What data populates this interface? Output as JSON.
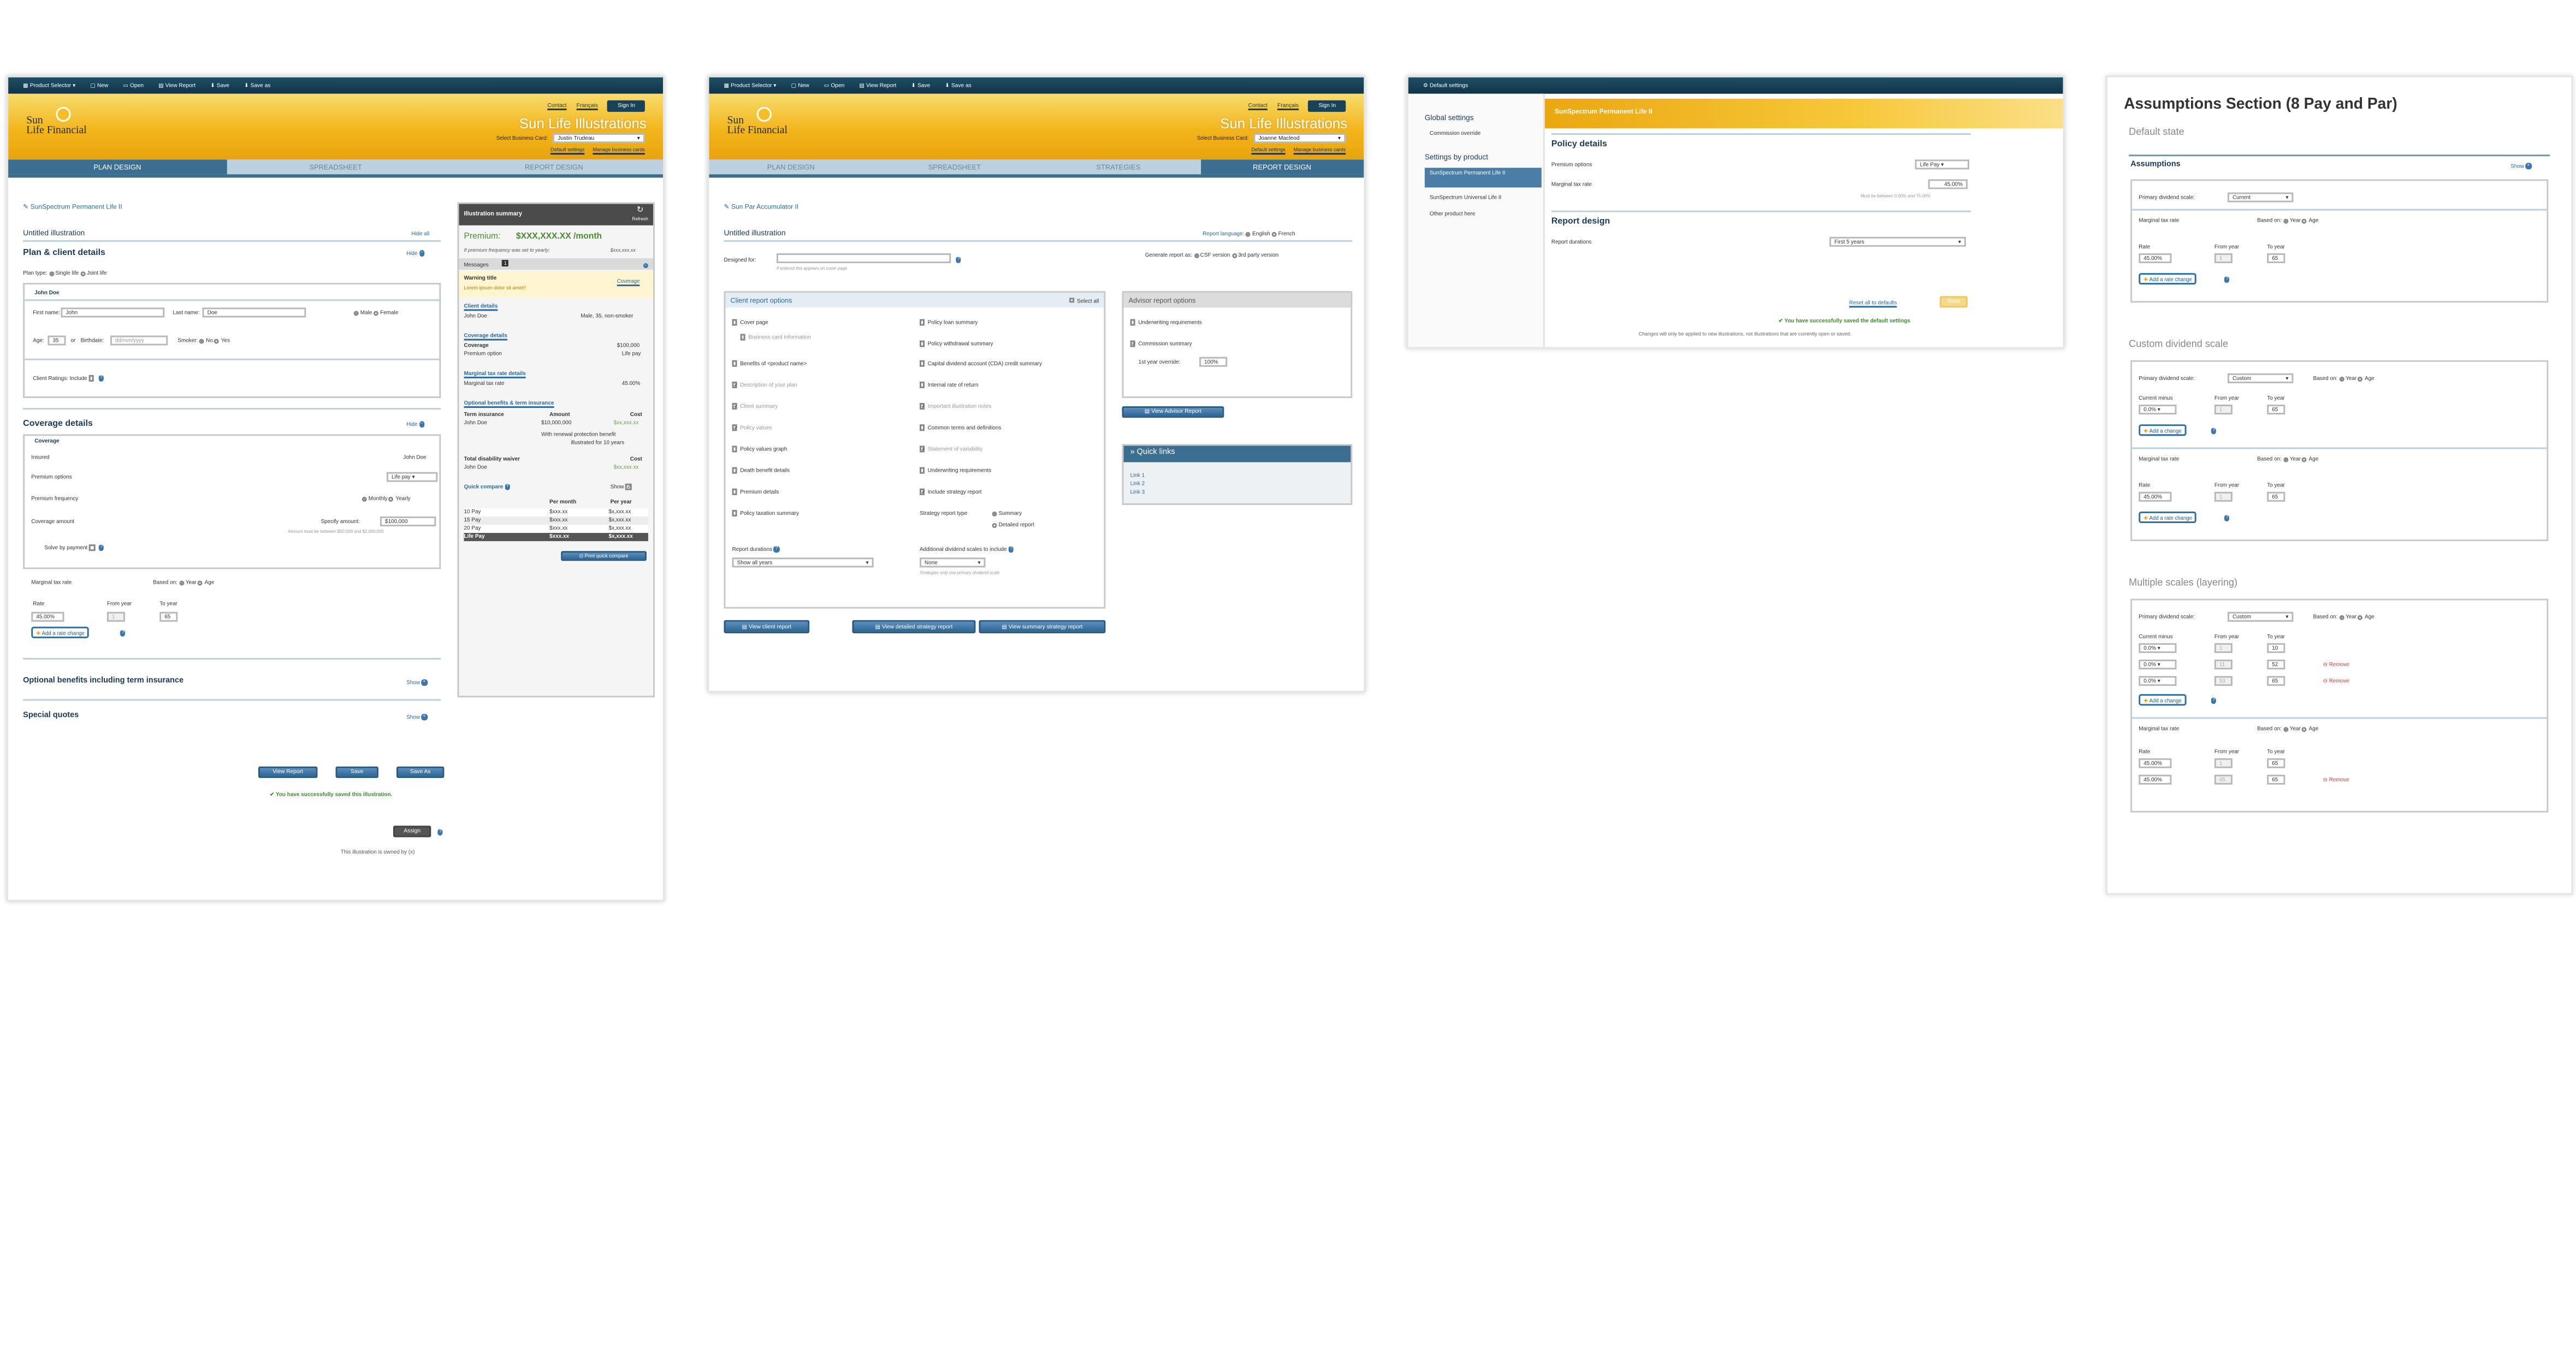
{
  "toolbar": {
    "product_selector": "Product Selector",
    "new": "New",
    "open": "Open",
    "view_report": "View Report",
    "save": "Save",
    "save_as": "Save as"
  },
  "header": {
    "contact": "Contact",
    "francais": "Français",
    "sign_in": "Sign In",
    "logo_line1": "Sun",
    "logo_line2": "Life Financial",
    "title": "Sun Life Illustrations",
    "select_card_label": "Select Business Card:",
    "default_settings": "Default settings",
    "manage_cards": "Manage business cards"
  },
  "screen1": {
    "business_card": "Justin Trudeau",
    "tabs": [
      "PLAN DESIGN",
      "SPREADSHEET",
      "REPORT DESIGN"
    ],
    "product": "SunSpectrum Permanent Life II",
    "illustration": "Untitled illustration",
    "hide_all": "Hide all",
    "hide": "Hide",
    "plan_client": "Plan & client details",
    "plan_type": "Plan type:",
    "single_life": "Single life",
    "joint_life": "Joint life",
    "client_name": "John Doe",
    "first_name_label": "First name:",
    "first_name": "John",
    "last_name_label": "Last name:",
    "last_name": "Doe",
    "male": "Male",
    "female": "Female",
    "age_label": "Age:",
    "age": "35",
    "or": "or",
    "birthdate_label": "Birthdate:",
    "birthdate_ph": "dd/mm/yyyy",
    "smoker_label": "Smoker:",
    "no": "No",
    "yes": "Yes",
    "client_ratings": "Client Ratings:",
    "include": "Include",
    "coverage_details": "Coverage details",
    "coverage": "Coverage",
    "insured": "Insured",
    "insured_value": "John Doe",
    "premium_options": "Premium options",
    "premium_value": "Life pay",
    "premium_frequency": "Premium frequency",
    "monthly": "Monthly",
    "yearly": "Yearly",
    "coverage_amount": "Coverage amount",
    "specify_amount": "Specify amount:",
    "amount": "$100,000",
    "amount_hint": "Amount must be between $50,000 and $2,000,000",
    "solve_by_premium": "Solve by payment",
    "marginal_tax": "Marginal tax rate",
    "based_on": "Based on:",
    "year": "Year",
    "age_opt": "Age",
    "rate": "Rate",
    "from_year": "From year",
    "to_year": "To year",
    "rate_value": "45.00%",
    "from_value": "1",
    "to_value": "65",
    "add_rate": "Add a rate change",
    "optional_benefits": "Optional benefits including term insurance",
    "show": "Show",
    "special_quotes": "Special quotes",
    "view_report": "View Report",
    "save": "Save",
    "save_as": "Save As",
    "success": "You have successfully saved this illustration.",
    "assign": "Assign",
    "owned_by": "This illustration is owned by (x)"
  },
  "summary": {
    "title": "Illustration summary",
    "refresh": "Refresh",
    "premium_label": "Premium:",
    "premium_value": "$XXX,XXX.XX /month",
    "premium_note": "If premium frequency was set to yearly:",
    "premium_note_value": "$xxx,xxx.xx",
    "messages": "Messages",
    "messages_count": "1",
    "warning_title": "Warning title",
    "warning_text": "Lorem ipsum dolor sit amet!!",
    "warning_link": "Coverage",
    "client_details": "Client details",
    "client_name": "John Doe",
    "client_desc": "Male, 35, non-smoker",
    "coverage_details": "Coverage details",
    "coverage": "Coverage",
    "coverage_value": "$100,000",
    "premium_option": "Premium option",
    "premium_option_value": "Life pay",
    "marginal_details": "Marginal tax rate details",
    "marginal": "Marginal tax rate",
    "marginal_value": "45.00%",
    "optional": "Optional benefits & term insurance",
    "term": "Term insurance",
    "amount": "Amount",
    "cost": "Cost",
    "term_name": "John Doe",
    "term_amount": "$10,000,000",
    "term_cost": "$xx,xxx.xx",
    "renewal": "With renewal protection benefit",
    "illustrated": "illustrated for 10 years",
    "waiver": "Total disability waiver",
    "waiver_cost": "Cost",
    "waiver_name": "John Doe",
    "waiver_value": "$xx,xxx.xx",
    "quick_compare": "Quick compare",
    "per_month": "Per month",
    "per_year": "Per year",
    "compare_rows": [
      [
        "10 Pay",
        "$xxx.xx",
        "$x,xxx.xx"
      ],
      [
        "15 Pay",
        "$xxx.xx",
        "$x,xxx.xx"
      ],
      [
        "20 Pay",
        "$xxx.xx",
        "$x,xxx.xx"
      ],
      [
        "Life Pay",
        "$xxx.xx",
        "$x,xxx.xx"
      ]
    ],
    "print": "Print quick compare"
  },
  "screen2": {
    "business_card": "Joanne Macleod",
    "tabs": [
      "PLAN DESIGN",
      "SPREADSHEET",
      "STRATEGIES",
      "REPORT DESIGN"
    ],
    "product": "Sun Par Accumulator II",
    "illustration": "Untitled illustration",
    "report_language": "Report language:",
    "english": "English",
    "french": "French",
    "designed_for": "Designed for:",
    "designed_hint": "If entered this appears on cover page",
    "generate_as": "Generate report as:",
    "csf": "CSF version",
    "third_party": "3rd party version",
    "client_options": "Client report options",
    "select_all": "Select all",
    "left_options": [
      "Cover page",
      "Business card information",
      "Benefits of <product name>",
      "Description of your plan",
      "Client summary",
      "Policy values",
      "Policy values graph",
      "Death benefit details",
      "Premium details",
      "Policy taxation summary"
    ],
    "right_options": [
      "Policy loan summary",
      "Policy withdrawal summary",
      "Capital dividend account (CDA) credit summary",
      "Internal rate of return",
      "Important illustration notes",
      "Common terms and definitions",
      "Statement of variability",
      "Underwriting requirements",
      "Include strategy report"
    ],
    "strategy_type": "Strategy report type",
    "summary_opt": "Summary",
    "detailed": "Detailed report",
    "report_durations": "Report durations",
    "durations_value": "Show all years",
    "additional": "Additional dividend scales to include",
    "none": "None",
    "strategies_note": "Strategies only use primary dividend scale",
    "advisor_options": "Advisor report options",
    "underwriting": "Underwriting requirements",
    "commission": "Commission summary",
    "first_year": "1st year override:",
    "first_year_value": "100%",
    "view_advisor": "View Advisor Report",
    "quick_links": "Quick links",
    "links": [
      "Link 1",
      "Link 2",
      "Link 3"
    ],
    "view_client": "View client report",
    "view_detailed": "View detailed strategy report",
    "view_summary": "View summary strategy report"
  },
  "screen3": {
    "title": "Default settings",
    "global": "Global settings",
    "commission": "Commission override",
    "by_product": "Settings by product",
    "products": [
      "SunSpectrum Permanent Life II",
      "SunSpectrum Universal Life II",
      "Other product here"
    ],
    "product_header": "SunSpectrum Permanent Life II",
    "policy_details": "Policy details",
    "premium_options": "Premium options",
    "premium_value": "Life Pay",
    "marginal": "Marginal tax rate",
    "marginal_value": "45.00%",
    "marginal_hint": "Must be between 0.00% and 75.00%",
    "report_design": "Report design",
    "report_durations": "Report durations",
    "durations_value": "First 5 years",
    "reset": "Reset all to defaults",
    "save": "Save",
    "success": "You have successfully saved the default settings",
    "note": "Changes will only be applied to new illustrations, not illustrations that are currently open or saved."
  },
  "screen4": {
    "title": "Assumptions Section (8 Pay and Par)",
    "default_state": "Default state",
    "assumptions": "Assumptions",
    "show": "Show",
    "primary": "Primary dividend scale:",
    "current": "Current",
    "custom": "Custom",
    "marginal": "Marginal tax rate",
    "based_on": "Based on:",
    "year": "Year",
    "age": "Age",
    "rate": "Rate",
    "from_year": "From year",
    "to_year": "To year",
    "current_minus": "Current minus",
    "add_rate": "Add a rate change",
    "add_change": "Add a change",
    "custom_scale": "Custom dividend scale",
    "multiple": "Multiple scales (layering)",
    "remove": "Remove",
    "v_rate": "45.00%",
    "v_one": "1",
    "v_65": "65",
    "v_zero": "0.0%",
    "v_10": "10",
    "v_11": "11",
    "v_52": "52",
    "v_53": "53"
  }
}
